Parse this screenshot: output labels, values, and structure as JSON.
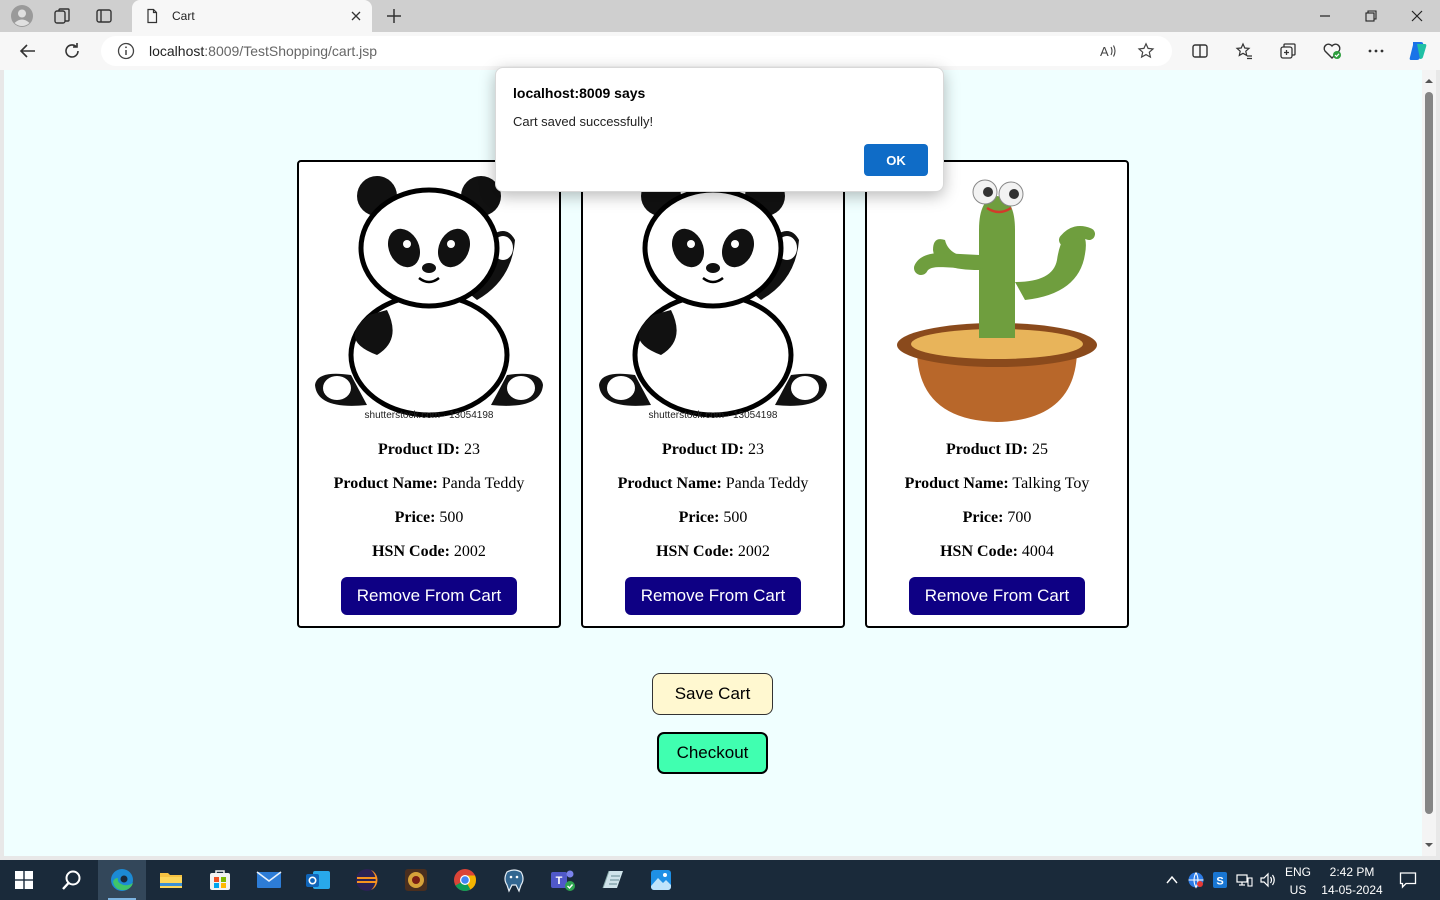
{
  "browser": {
    "tab_title": "Cart",
    "url_host": "localhost",
    "url_rest": ":8009/TestShopping/cart.jsp"
  },
  "dialog": {
    "title": "localhost:8009 says",
    "message": "Cart saved successfully!",
    "ok_label": "OK"
  },
  "cart": {
    "field_labels": {
      "id": "Product ID:",
      "name": "Product Name:",
      "price": "Price:",
      "hsn": "HSN Code:"
    },
    "remove_label": "Remove From Cart",
    "items": [
      {
        "id": "23",
        "name": "Panda Teddy",
        "price": "500",
        "hsn": "2002",
        "image": "panda-teddy",
        "image_caption": "shutterstock.com · 13054198"
      },
      {
        "id": "23",
        "name": "Panda Teddy",
        "price": "500",
        "hsn": "2002",
        "image": "panda-teddy",
        "image_caption": "shutterstock.com · 13054198"
      },
      {
        "id": "25",
        "name": "Talking Toy",
        "price": "700",
        "hsn": "4004",
        "image": "talking-cactus-toy"
      }
    ]
  },
  "actions": {
    "save_label": "Save Cart",
    "checkout_label": "Checkout"
  },
  "taskbar": {
    "language": "ENG",
    "region": "US",
    "time": "2:42 PM",
    "date": "14-05-2024"
  },
  "colors": {
    "page_bg": "#f0ffff",
    "remove_btn": "#0e0084",
    "save_btn": "#fff8d0",
    "checkout_btn": "#40ffb0",
    "dialog_ok": "#0f6cc7"
  }
}
